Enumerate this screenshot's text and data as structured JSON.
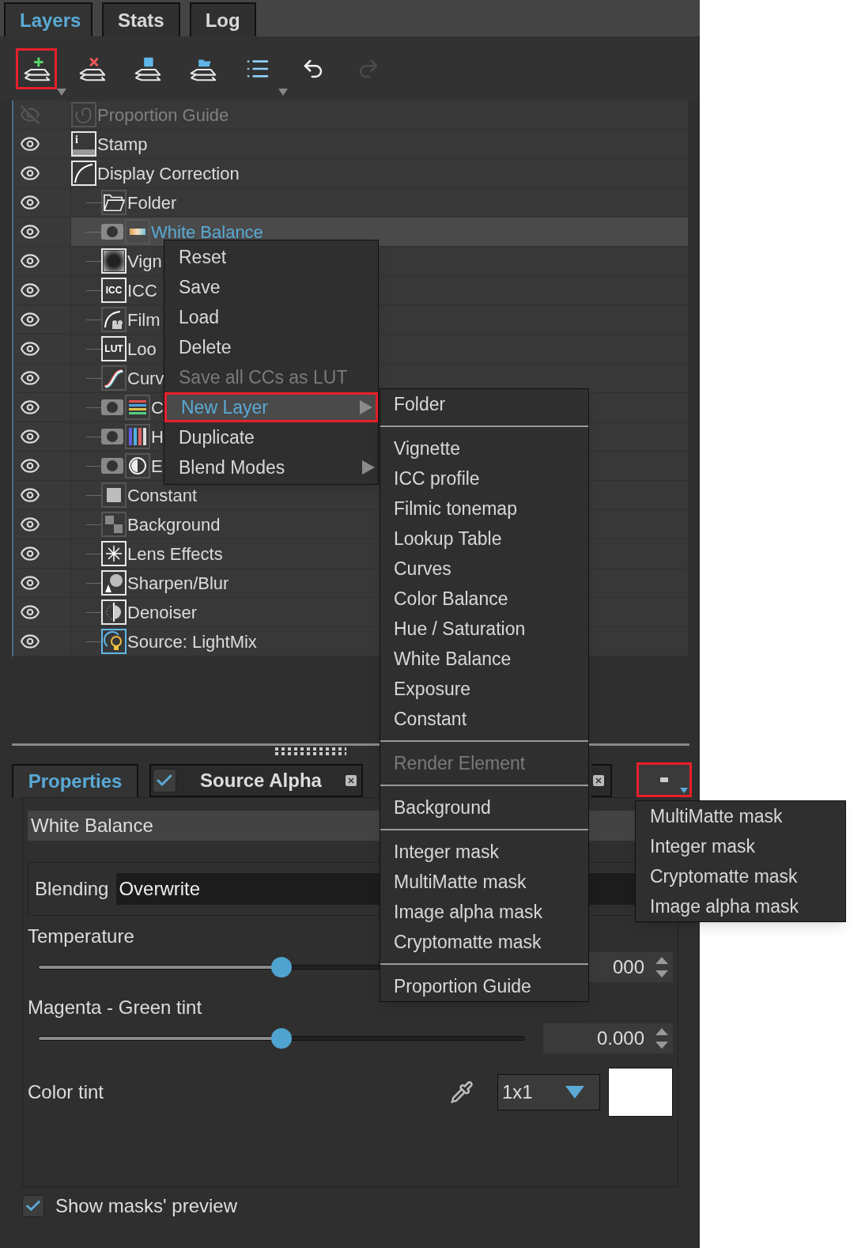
{
  "tabs": [
    {
      "label": "Layers",
      "selected": true
    },
    {
      "label": "Stats",
      "selected": false
    },
    {
      "label": "Log",
      "selected": false
    }
  ],
  "toolbar": [
    {
      "kind": "add",
      "highlighted": true,
      "dropdown": true,
      "disabled": false
    },
    {
      "kind": "delete",
      "highlighted": false,
      "disabled": false
    },
    {
      "kind": "save",
      "highlighted": false,
      "disabled": false
    },
    {
      "kind": "load",
      "highlighted": false,
      "disabled": false
    },
    {
      "kind": "list",
      "highlighted": false,
      "dropdown": true,
      "disabled": false
    },
    {
      "kind": "undo",
      "highlighted": false,
      "disabled": false
    },
    {
      "kind": "redo",
      "highlighted": false,
      "disabled": true
    }
  ],
  "layers": [
    {
      "name": "Proportion Guide",
      "kind": "spiral",
      "visible": false,
      "selected": false,
      "mask": false
    },
    {
      "name": "Stamp",
      "kind": "stamp",
      "icon_text": "i",
      "visible": true,
      "selected": false,
      "mask": false
    },
    {
      "name": "Display Correction",
      "kind": "curve",
      "visible": true,
      "selected": false,
      "mask": false,
      "children": [
        {
          "name": "Folder",
          "kind": "folder",
          "visible": true,
          "selected": false,
          "mask": false
        },
        {
          "name": "White Balance",
          "kind": "gradient",
          "visible": true,
          "selected": true,
          "mask": true
        },
        {
          "name": "Vign",
          "kind": "vignette",
          "visible": true,
          "selected": false,
          "mask": false
        },
        {
          "name": "ICC",
          "kind": "label",
          "icon_text": "ICC",
          "visible": true,
          "selected": false,
          "mask": false
        },
        {
          "name": "Film",
          "kind": "filmic",
          "visible": true,
          "selected": false,
          "mask": false
        },
        {
          "name": "Loo",
          "kind": "label",
          "icon_text": "LUT",
          "visible": true,
          "selected": false,
          "mask": false
        },
        {
          "name": "Curv",
          "kind": "scurve",
          "visible": true,
          "selected": false,
          "mask": false
        },
        {
          "name": "C",
          "kind": "bars",
          "visible": true,
          "selected": false,
          "mask": true
        },
        {
          "name": "H",
          "kind": "columns",
          "visible": true,
          "selected": false,
          "mask": true
        },
        {
          "name": "E",
          "kind": "halfcircle",
          "visible": true,
          "selected": false,
          "mask": true
        },
        {
          "name": "Constant",
          "kind": "square",
          "visible": true,
          "selected": false,
          "mask": false
        },
        {
          "name": "Background",
          "kind": "checker",
          "visible": true,
          "selected": false,
          "mask": false
        },
        {
          "name": "Lens Effects",
          "kind": "star",
          "visible": true,
          "selected": false,
          "mask": false
        },
        {
          "name": "Sharpen/Blur",
          "kind": "sharpen",
          "visible": true,
          "selected": false,
          "mask": false
        },
        {
          "name": "Denoiser",
          "kind": "denoise",
          "visible": true,
          "selected": false,
          "mask": false
        },
        {
          "name": "Source: LightMix",
          "kind": "bulb",
          "visible": true,
          "selected": false,
          "mask": false
        }
      ]
    }
  ],
  "context_menu": [
    {
      "label": "Reset",
      "disabled": false,
      "selected": false,
      "submenu": false,
      "highlighted": false
    },
    {
      "label": "Save",
      "disabled": false,
      "selected": false,
      "submenu": false,
      "highlighted": false
    },
    {
      "label": "Load",
      "disabled": false,
      "selected": false,
      "submenu": false,
      "highlighted": false
    },
    {
      "label": "Delete",
      "disabled": false,
      "selected": false,
      "submenu": false,
      "highlighted": false
    },
    {
      "label": "Save all CCs as LUT",
      "disabled": true,
      "selected": false,
      "submenu": false,
      "highlighted": false
    },
    {
      "label": "New Layer",
      "disabled": false,
      "selected": true,
      "submenu": true,
      "highlighted": true
    },
    {
      "label": "Duplicate",
      "disabled": false,
      "selected": false,
      "submenu": false,
      "highlighted": false
    },
    {
      "label": "Blend Modes",
      "disabled": false,
      "selected": false,
      "submenu": true,
      "highlighted": false
    }
  ],
  "new_layer_menu": [
    {
      "kind": "item",
      "label": "Folder",
      "disabled": false
    },
    {
      "kind": "separator"
    },
    {
      "kind": "item",
      "label": "Vignette",
      "disabled": false
    },
    {
      "kind": "item",
      "label": "ICC profile",
      "disabled": false
    },
    {
      "kind": "item",
      "label": "Filmic tonemap",
      "disabled": false
    },
    {
      "kind": "item",
      "label": "Lookup Table",
      "disabled": false
    },
    {
      "kind": "item",
      "label": "Curves",
      "disabled": false
    },
    {
      "kind": "item",
      "label": "Color Balance",
      "disabled": false
    },
    {
      "kind": "item",
      "label": "Hue / Saturation",
      "disabled": false
    },
    {
      "kind": "item",
      "label": "White Balance",
      "disabled": false
    },
    {
      "kind": "item",
      "label": "Exposure",
      "disabled": false
    },
    {
      "kind": "item",
      "label": "Constant",
      "disabled": false
    },
    {
      "kind": "separator"
    },
    {
      "kind": "item",
      "label": "Render Element",
      "disabled": true
    },
    {
      "kind": "separator"
    },
    {
      "kind": "item",
      "label": "Background",
      "disabled": false
    },
    {
      "kind": "separator"
    },
    {
      "kind": "item",
      "label": "Integer mask",
      "disabled": false
    },
    {
      "kind": "item",
      "label": "MultiMatte mask",
      "disabled": false
    },
    {
      "kind": "item",
      "label": "Image alpha mask",
      "disabled": false
    },
    {
      "kind": "item",
      "label": "Cryptomatte mask",
      "disabled": false
    },
    {
      "kind": "separator"
    },
    {
      "kind": "item",
      "label": "Proportion Guide",
      "disabled": false
    }
  ],
  "property_tabs": [
    {
      "kind": "tab",
      "label": "Properties",
      "selected": true
    },
    {
      "kind": "mask_tab",
      "label": "Source Alpha",
      "checked": true,
      "selected": false
    },
    {
      "kind": "mask_tab",
      "selected": false
    }
  ],
  "mask_button": {
    "highlighted": true
  },
  "mask_menu": [
    "MultiMatte mask",
    "Integer mask",
    "Cryptomatte mask",
    "Image alpha mask"
  ],
  "properties": {
    "name": "White Balance",
    "blending_label": "Blending",
    "blending_value": "Overwrite",
    "sliders": [
      {
        "label": "Temperature",
        "level": 0.5,
        "value": "000"
      },
      {
        "label": "Magenta - Green tint",
        "level": 0.5,
        "value": "0.000"
      }
    ],
    "color_tint": {
      "label": "Color tint",
      "sample_size": "1x1",
      "color": "#ffffff"
    }
  },
  "show_masks_preview": {
    "label": "Show masks' preview",
    "checked": true
  }
}
